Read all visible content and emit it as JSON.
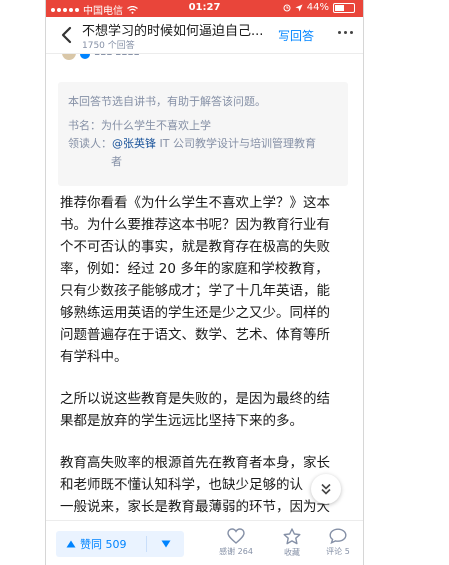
{
  "status_bar": {
    "carrier": "中国电信",
    "time": "01:27",
    "battery": "44%",
    "battery_level": 0.44
  },
  "navbar": {
    "title": "不想学习的时候如何逼迫自己...",
    "answer_count": "1750 个回答",
    "write_answer": "写回答"
  },
  "source_box": {
    "intro": "本回答节选自讲书，有助于解答该问题。",
    "book_line": "书名：为什么学生不喜欢上学",
    "reader_label": "领读人：",
    "reader_name": "@张英锋",
    "reader_title_1": " IT 公司教学设计与培训管理教育",
    "reader_title_2": "者"
  },
  "article": {
    "paragraph_1": [
      "推荐你看看《为什么学生不喜欢上学？》这本",
      "书。为什么要推荐这本书呢？因为教育行业有",
      "个不可否认的事实，就是教育存在极高的失败",
      "率，例如：经过 20 多年的家庭和学校教育，",
      "只有少数孩子能够成才；学了十几年英语，能",
      "够熟练运用英语的学生还是少之又少。同样的",
      "问题普遍存在于语文、数学、艺术、体育等所",
      "有学科中。"
    ],
    "paragraph_2": [
      "之所以说这些教育是失败的，是因为最终的结",
      "果都是放弃的学生远远比坚持下来的多。"
    ],
    "paragraph_3": [
      "教育高失败率的根源首先在教育者本身，家长",
      "和老师既不懂认知科学，也缺少足够的认",
      "一般说来，家长是教育最薄弱的环节，因为大"
    ]
  },
  "bottom_bar": {
    "upvote": "赞同 509",
    "thanks": "感谢 264",
    "collect": "收藏",
    "comment": "评论 5"
  },
  "colors": {
    "status_bar_bg": "#e9453a",
    "accent": "#0084ff",
    "muted": "#8590a6"
  }
}
